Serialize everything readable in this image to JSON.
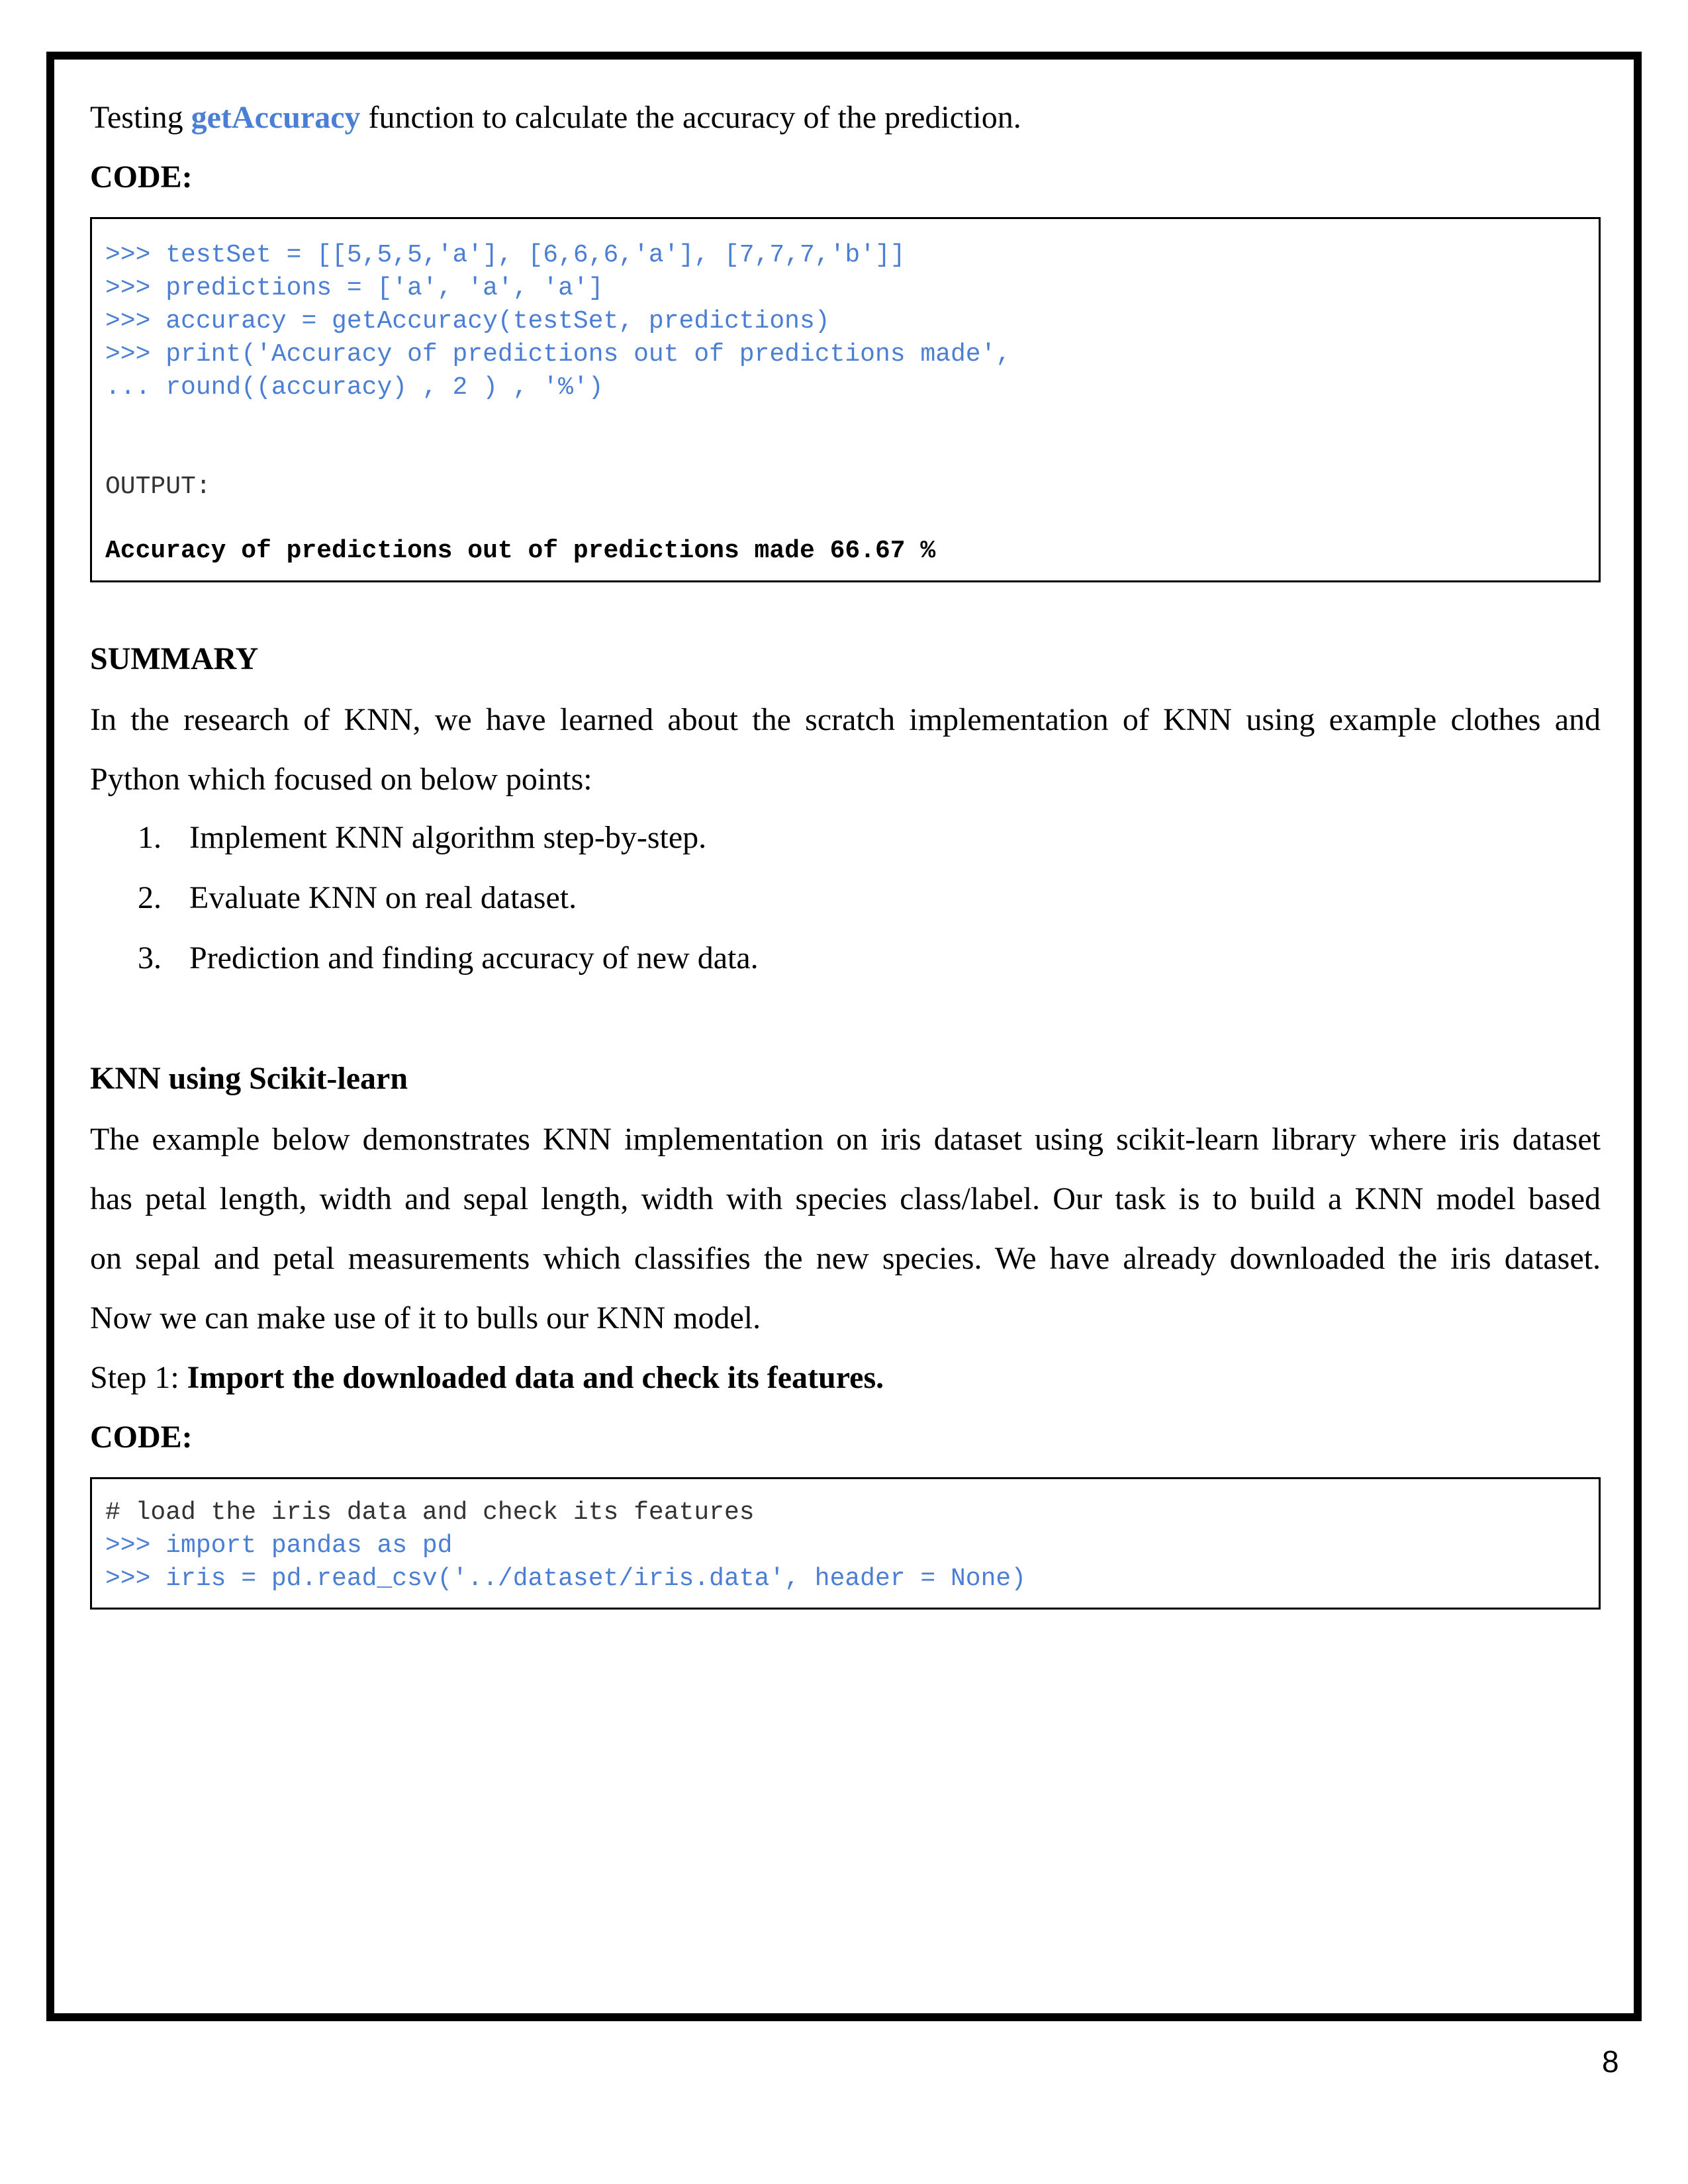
{
  "intro": {
    "prefix": "Testing ",
    "function_name": "getAccuracy",
    "suffix": " function to calculate the accuracy of the prediction."
  },
  "code_label_1": "CODE:",
  "code_block_1": {
    "lines": [
      ">>> testSet = [[5,5,5,'a'], [6,6,6,'a'], [7,7,7,'b']]",
      ">>> predictions = ['a', 'a', 'a']",
      ">>> accuracy = getAccuracy(testSet, predictions)",
      ">>> print('Accuracy of predictions out of predictions made',",
      "... round((accuracy) , 2 ) , '%')"
    ],
    "output_label": "OUTPUT:",
    "output_text": "Accuracy of predictions out of predictions made 66.67 %"
  },
  "summary": {
    "heading": "SUMMARY",
    "line1": "In the research of KNN, we have learned about the scratch implementation of KNN using example clothes and",
    "line2": "Python which focused on below points:",
    "items": [
      {
        "num": "1.",
        "text": "Implement KNN algorithm step-by-step."
      },
      {
        "num": "2.",
        "text": "Evaluate KNN on real dataset."
      },
      {
        "num": "3.",
        "text": "Prediction and finding accuracy of new data."
      }
    ]
  },
  "sklearn": {
    "heading": "KNN using Scikit-learn",
    "lines": [
      "The example below demonstrates KNN implementation on iris dataset using scikit-learn library where iris dataset",
      "has petal length, width and sepal length, width with species class/label. Our task is to build a KNN model based",
      "on sepal and petal measurements which classifies the new species. We have already downloaded the iris dataset.",
      "Now we can make use of it to bulls our KNN model."
    ],
    "step_prefix": "Step 1: ",
    "step_text": "Import the downloaded data and check its features.",
    "code_label": "CODE:"
  },
  "code_block_2": {
    "comment": "# load the iris data and check its features",
    "lines": [
      ">>> import pandas as pd",
      ">>> iris = pd.read_csv('../dataset/iris.data', header = None)"
    ]
  },
  "page_number": "8"
}
